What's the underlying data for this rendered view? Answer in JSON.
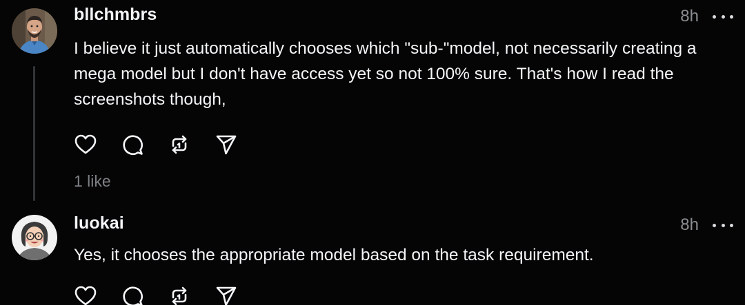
{
  "posts": [
    {
      "username": "bllchmbrs",
      "time": "8h",
      "text": "I believe it just automatically chooses which \"sub-\"model, not necessarily creating a mega model but I don't have access yet so not 100% sure. That's how I read the screenshots though,",
      "likes": "1 like"
    },
    {
      "username": "luokai",
      "time": "8h",
      "text": "Yes, it chooses the appropriate model based on the task requirement."
    }
  ],
  "icons": [
    "heart-icon",
    "comment-icon",
    "repost-icon",
    "share-icon",
    "more-icon"
  ],
  "colors": {
    "background": "#050505",
    "text": "#f3f5f7",
    "muted": "#8a8d91",
    "thread_line": "#333638"
  }
}
